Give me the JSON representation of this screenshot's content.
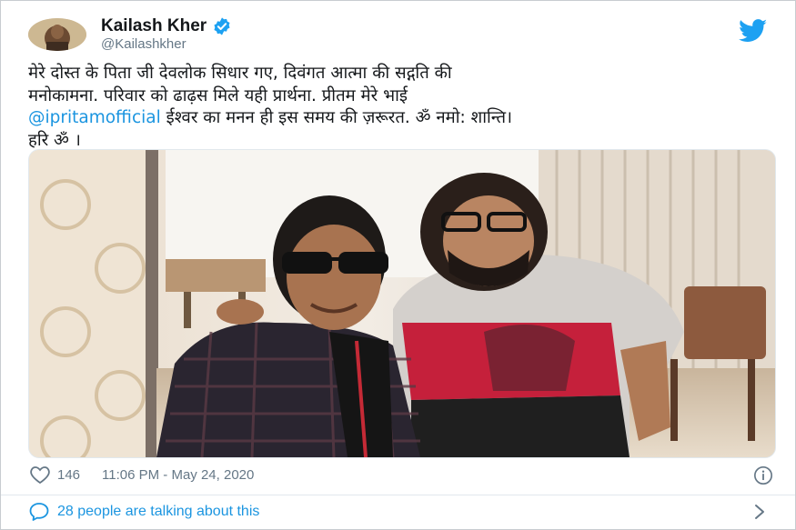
{
  "tweet": {
    "author_name": "Kailash Kher",
    "author_handle": "@Kailashkher",
    "text_line1": "मेरे दोस्त के पिता जी देवलोक सिधार गए, दिवंगत आत्मा की सद्गति की",
    "text_line2": "मनोकामना. परिवार को ढाढ़स मिले यही प्रार्थना. प्रीतम मेरे भाई",
    "mention": "@ipritamofficial",
    "text_line3_rest": " ईश्वर का मनन ही इस समय की ज़रूरत. ॐ नमो: शान्ति।",
    "text_line4": "हरि ॐ ।",
    "likes": "146",
    "timestamp": "11:06 PM - May 24, 2020",
    "talking_text": "28 people are talking about this"
  },
  "colors": {
    "twitter_blue": "#1b95e0",
    "text": "#14171a",
    "muted": "#657786"
  },
  "icons": {
    "verified": "verified-badge-icon",
    "bird": "twitter-bird-icon",
    "heart": "heart-icon",
    "info": "info-icon",
    "comment": "comment-bubble-icon",
    "chevron": "chevron-right-icon"
  }
}
